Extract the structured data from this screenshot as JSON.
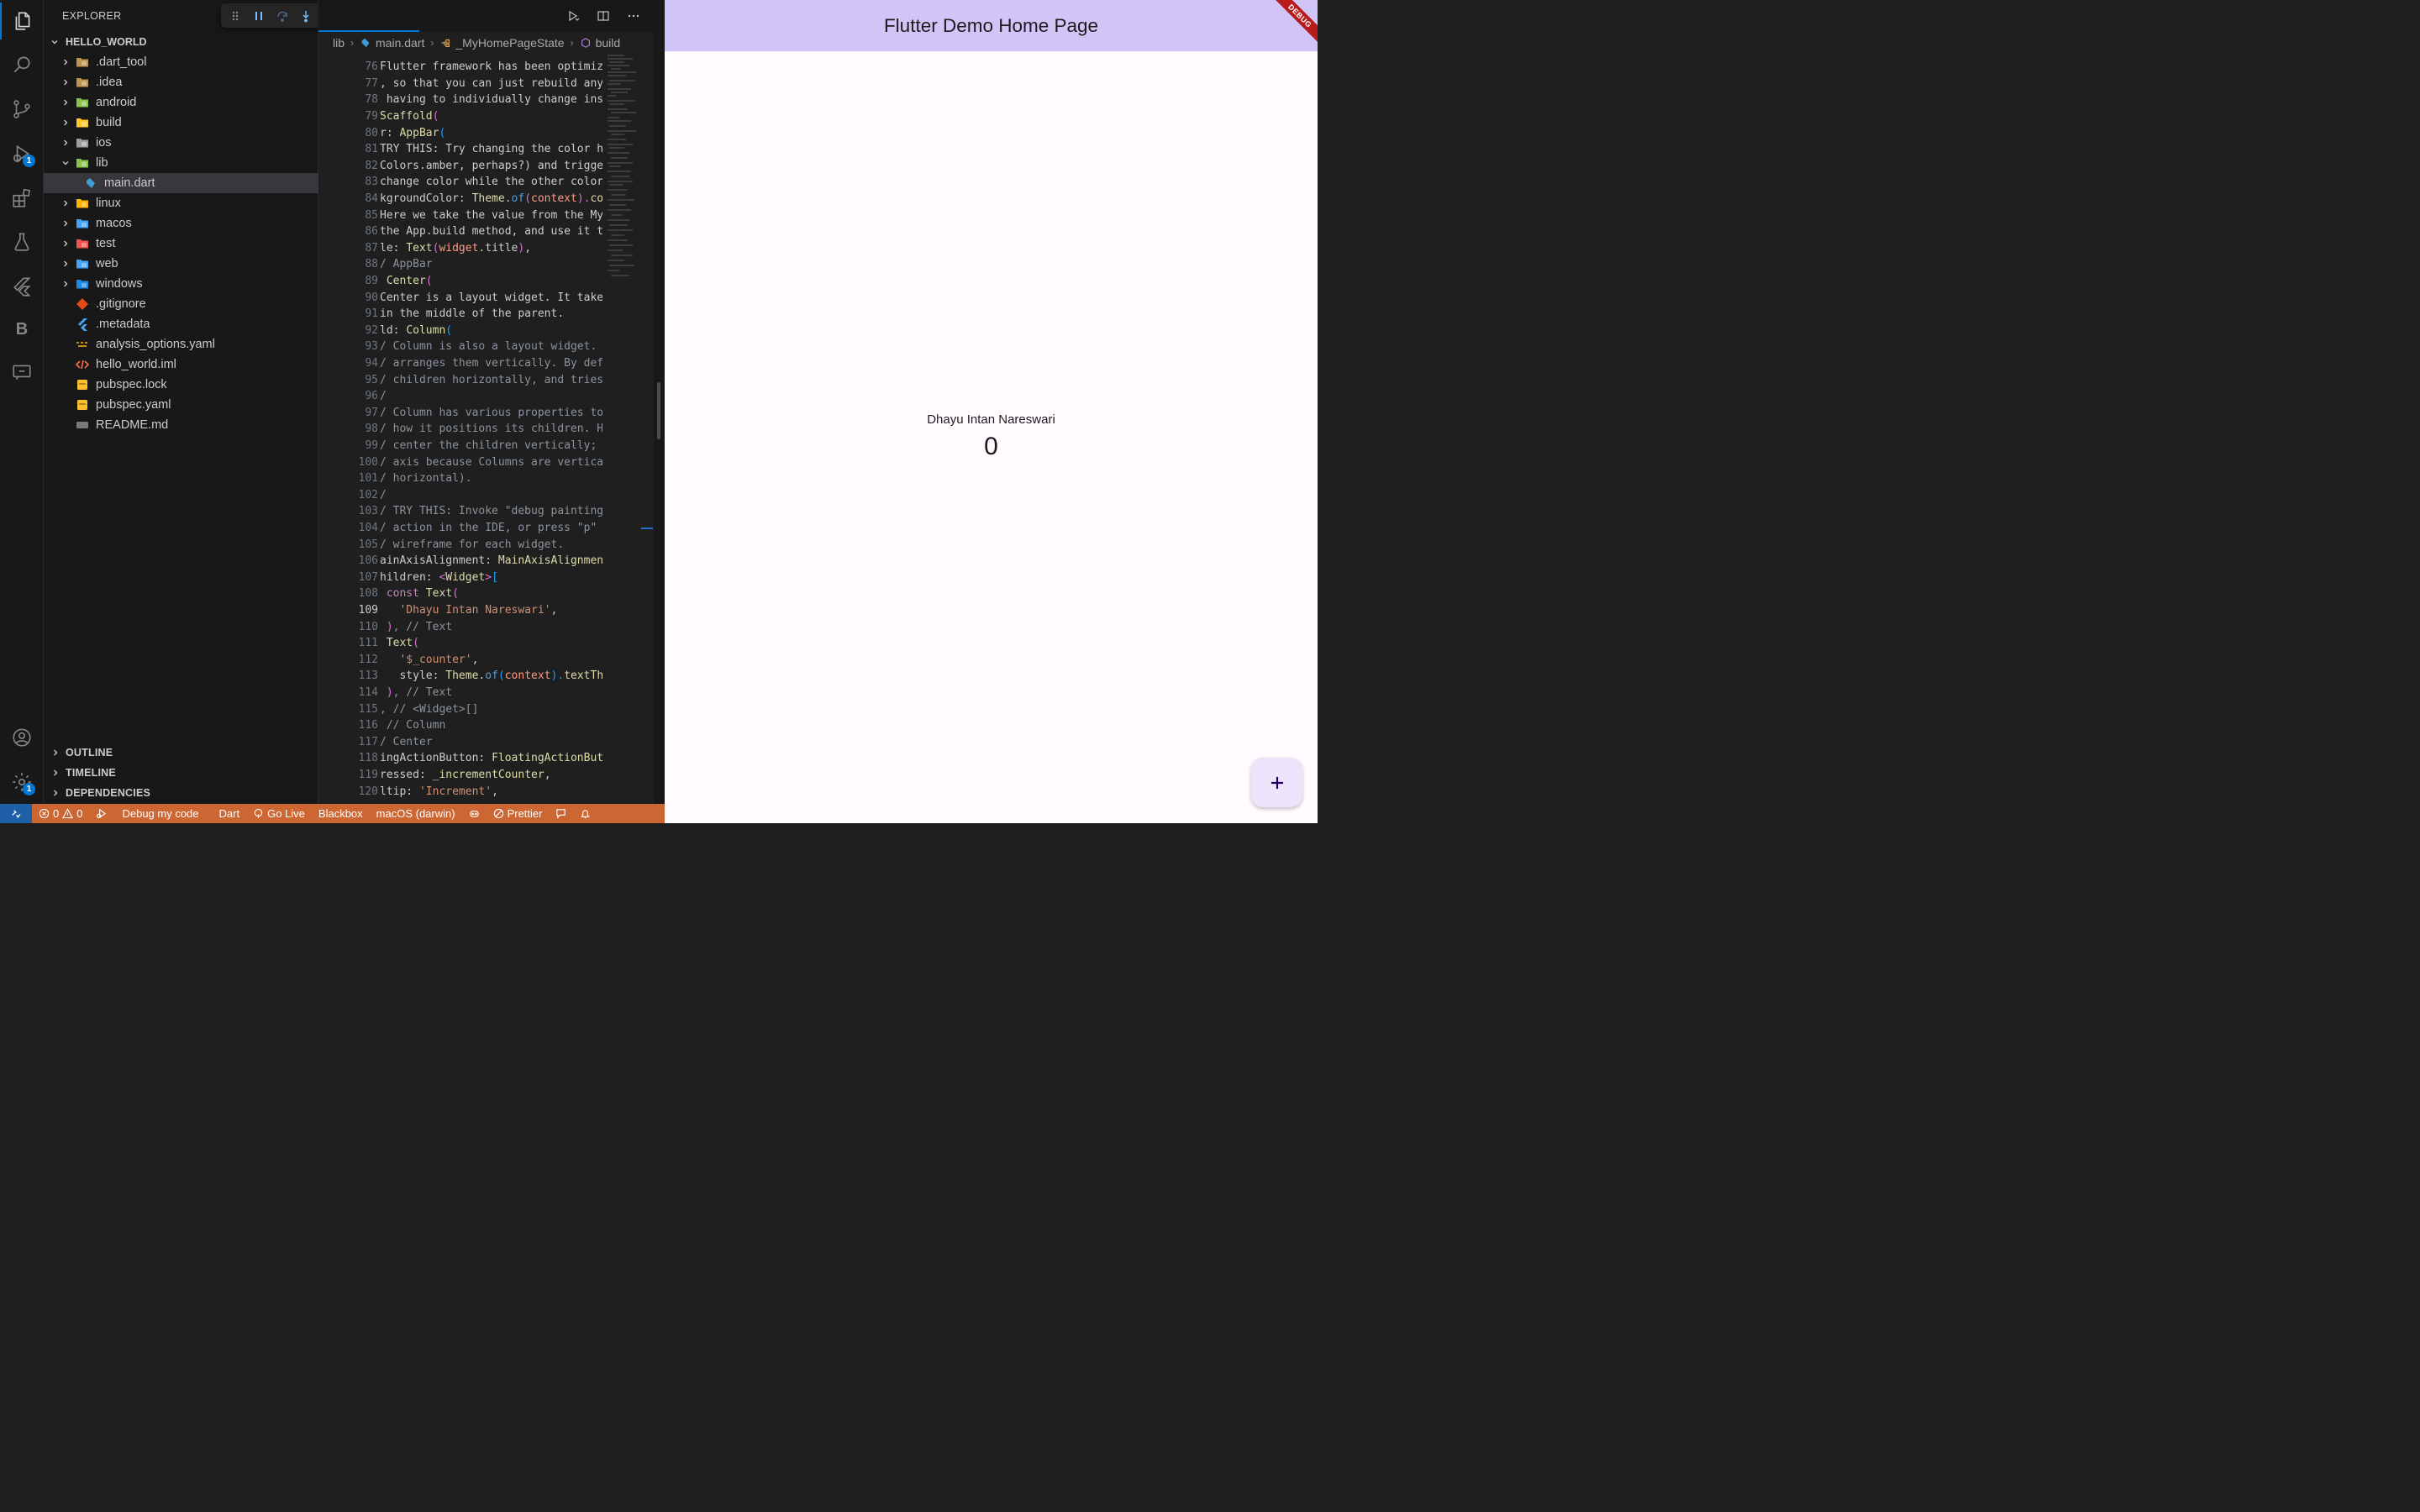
{
  "explorer": {
    "title": "EXPLORER",
    "root": "HELLO_WORLD",
    "items": [
      {
        "label": ".dart_tool",
        "kind": "folder",
        "icon": "folder-icon",
        "expanded": false
      },
      {
        "label": ".idea",
        "kind": "folder",
        "icon": "folder-idea-icon",
        "expanded": false
      },
      {
        "label": "android",
        "kind": "folder",
        "icon": "folder-android-icon",
        "expanded": false
      },
      {
        "label": "build",
        "kind": "folder",
        "icon": "folder-build-icon",
        "expanded": false
      },
      {
        "label": "ios",
        "kind": "folder",
        "icon": "folder-ios-icon",
        "expanded": false
      },
      {
        "label": "lib",
        "kind": "folder",
        "icon": "folder-lib-icon",
        "expanded": true
      },
      {
        "label": "main.dart",
        "kind": "file",
        "icon": "dart-file-icon",
        "selected": true
      },
      {
        "label": "linux",
        "kind": "folder",
        "icon": "folder-linux-icon",
        "expanded": false
      },
      {
        "label": "macos",
        "kind": "folder",
        "icon": "folder-macos-icon",
        "expanded": false
      },
      {
        "label": "test",
        "kind": "folder",
        "icon": "folder-test-icon",
        "expanded": false
      },
      {
        "label": "web",
        "kind": "folder",
        "icon": "folder-web-icon",
        "expanded": false
      },
      {
        "label": "windows",
        "kind": "folder",
        "icon": "folder-windows-icon",
        "expanded": false
      },
      {
        "label": ".gitignore",
        "kind": "file",
        "icon": "git-file-icon"
      },
      {
        "label": ".metadata",
        "kind": "file",
        "icon": "flutter-file-icon"
      },
      {
        "label": "analysis_options.yaml",
        "kind": "file",
        "icon": "yaml-file-icon"
      },
      {
        "label": "hello_world.iml",
        "kind": "file",
        "icon": "xml-file-icon"
      },
      {
        "label": "pubspec.lock",
        "kind": "file",
        "icon": "lock-file-icon"
      },
      {
        "label": "pubspec.yaml",
        "kind": "file",
        "icon": "pubspec-file-icon"
      },
      {
        "label": "README.md",
        "kind": "file",
        "icon": "markdown-file-icon"
      }
    ],
    "sections": [
      "OUTLINE",
      "TIMELINE",
      "DEPENDENCIES"
    ]
  },
  "activity_bar": {
    "icons": [
      "explorer-icon",
      "search-icon",
      "source-control-icon",
      "run-debug-icon",
      "extensions-icon",
      "testing-icon",
      "flutter-icon",
      "blackbox-icon",
      "remote-explorer-icon",
      "account-icon",
      "settings-icon"
    ],
    "debug_badge": "1",
    "settings_badge": "1"
  },
  "debug_toolbar": {
    "buttons": [
      "drag-handle-icon",
      "pause-icon",
      "step-over-icon",
      "step-into-icon",
      "step-out-icon",
      "hot-reload-icon",
      "hot-restart-icon",
      "stop-icon",
      "devtools-icon"
    ]
  },
  "breadcrumb": {
    "folder": "lib",
    "file": "main.dart",
    "class": "_MyHomePageState",
    "method": "build"
  },
  "editor": {
    "current_line": 109,
    "lines": [
      {
        "n": "76",
        "t": [
          [
            "Flutter framework has been optimiz",
            "#cccccc"
          ]
        ]
      },
      {
        "n": "77",
        "t": [
          [
            ", so that you can just rebuild any",
            "#cccccc"
          ]
        ]
      },
      {
        "n": "78",
        "t": [
          [
            " having to individually change ins",
            "#cccccc"
          ]
        ]
      },
      {
        "n": "79",
        "t": [
          [
            "Scaffold",
            "#dcdcaa"
          ],
          [
            "(",
            "#da70d6"
          ]
        ]
      },
      {
        "n": "80",
        "t": [
          [
            "r",
            "#cccccc"
          ],
          [
            ": ",
            "#cccccc"
          ],
          [
            "AppBar",
            "#dcdcaa"
          ],
          [
            "(",
            "#179fff"
          ]
        ]
      },
      {
        "n": "81",
        "t": [
          [
            "TRY THIS: Try changing the color h",
            "#cccccc"
          ]
        ]
      },
      {
        "n": "82",
        "t": [
          [
            "Colors.amber, perhaps?) and trigge",
            "#cccccc"
          ]
        ]
      },
      {
        "n": "83",
        "t": [
          [
            "change color while the other color",
            "#cccccc"
          ]
        ]
      },
      {
        "n": "84",
        "t": [
          [
            "kgroundColor: ",
            "#cccccc"
          ],
          [
            "Theme",
            "#dcdcaa"
          ],
          [
            ".",
            "#cccccc"
          ],
          [
            "of",
            "#569cd6"
          ],
          [
            "(",
            "#da70d6"
          ],
          [
            "context",
            "#ff9b82"
          ],
          [
            ").",
            "#da70d6"
          ],
          [
            "co",
            "#dcdcaa"
          ]
        ]
      },
      {
        "n": "85",
        "t": [
          [
            "Here we take the value from the My",
            "#cccccc"
          ]
        ]
      },
      {
        "n": "86",
        "t": [
          [
            "the App.build method, and use it t",
            "#cccccc"
          ]
        ]
      },
      {
        "n": "87",
        "t": [
          [
            "le: ",
            "#cccccc"
          ],
          [
            "Text",
            "#dcdcaa"
          ],
          [
            "(",
            "#da70d6"
          ],
          [
            "widget",
            "#ff9b82"
          ],
          [
            ".title",
            "#cccccc"
          ],
          [
            ")",
            "#da70d6"
          ],
          [
            ",",
            "#cccccc"
          ]
        ]
      },
      {
        "n": "88",
        "t": [
          [
            "/ AppBar",
            "#8b949e"
          ]
        ]
      },
      {
        "n": "89",
        "t": [
          [
            " Center",
            "#dcdcaa"
          ],
          [
            "(",
            "#da70d6"
          ]
        ]
      },
      {
        "n": "90",
        "t": [
          [
            "Center is a layout widget. It take",
            "#cccccc"
          ]
        ]
      },
      {
        "n": "91",
        "t": [
          [
            "in the middle of the parent.",
            "#cccccc"
          ]
        ]
      },
      {
        "n": "92",
        "t": [
          [
            "ld: ",
            "#cccccc"
          ],
          [
            "Column",
            "#dcdcaa"
          ],
          [
            "(",
            "#179fff"
          ]
        ]
      },
      {
        "n": "93",
        "t": [
          [
            "/ Column is also a layout widget. ",
            "#8b949e"
          ]
        ]
      },
      {
        "n": "94",
        "t": [
          [
            "/ arranges them vertically. By def",
            "#8b949e"
          ]
        ]
      },
      {
        "n": "95",
        "t": [
          [
            "/ children horizontally, and tries",
            "#8b949e"
          ]
        ]
      },
      {
        "n": "96",
        "t": [
          [
            "/",
            "#8b949e"
          ]
        ]
      },
      {
        "n": "97",
        "t": [
          [
            "/ Column has various properties to",
            "#8b949e"
          ]
        ]
      },
      {
        "n": "98",
        "t": [
          [
            "/ how it positions its children. H",
            "#8b949e"
          ]
        ]
      },
      {
        "n": "99",
        "t": [
          [
            "/ center the children vertically; ",
            "#8b949e"
          ]
        ]
      },
      {
        "n": "100",
        "t": [
          [
            "/ axis because Columns are vertica",
            "#8b949e"
          ]
        ]
      },
      {
        "n": "101",
        "t": [
          [
            "/ horizontal).",
            "#8b949e"
          ]
        ]
      },
      {
        "n": "102",
        "t": [
          [
            "/",
            "#8b949e"
          ]
        ]
      },
      {
        "n": "103",
        "t": [
          [
            "/ TRY THIS: Invoke \"debug painting",
            "#8b949e"
          ]
        ]
      },
      {
        "n": "104",
        "t": [
          [
            "/ action in the IDE, or press \"p\" ",
            "#8b949e"
          ]
        ]
      },
      {
        "n": "105",
        "t": [
          [
            "/ wireframe for each widget.",
            "#8b949e"
          ]
        ]
      },
      {
        "n": "106",
        "t": [
          [
            "ainAxisAlignment: ",
            "#cccccc"
          ],
          [
            "MainAxisAlignmen",
            "#dcdcaa"
          ]
        ]
      },
      {
        "n": "107",
        "t": [
          [
            "hildren: ",
            "#cccccc"
          ],
          [
            "<",
            "#da70d6"
          ],
          [
            "Widget",
            "#dcdcaa"
          ],
          [
            ">",
            "#da70d6"
          ],
          [
            "[",
            "#179fff"
          ]
        ]
      },
      {
        "n": "108",
        "t": [
          [
            " const ",
            "#c586c0"
          ],
          [
            "Text",
            "#dcdcaa"
          ],
          [
            "(",
            "#da70d6"
          ]
        ]
      },
      {
        "n": "109",
        "t": [
          [
            "   ",
            "#cccccc"
          ],
          [
            "'Dhayu Intan Nareswari'",
            "#ce9178"
          ],
          [
            ",",
            "#cccccc"
          ]
        ]
      },
      {
        "n": "110",
        "t": [
          [
            " )",
            "#da70d6"
          ],
          [
            ", // Text",
            "#8b949e"
          ]
        ]
      },
      {
        "n": "111",
        "t": [
          [
            " Text",
            "#dcdcaa"
          ],
          [
            "(",
            "#da70d6"
          ]
        ]
      },
      {
        "n": "112",
        "t": [
          [
            "   ",
            "#cccccc"
          ],
          [
            "'$_counter'",
            "#ce9178"
          ],
          [
            ",",
            "#cccccc"
          ]
        ]
      },
      {
        "n": "113",
        "t": [
          [
            "   style: ",
            "#cccccc"
          ],
          [
            "Theme",
            "#dcdcaa"
          ],
          [
            ".",
            "#cccccc"
          ],
          [
            "of",
            "#569cd6"
          ],
          [
            "(",
            "#179fff"
          ],
          [
            "context",
            "#ff9b82"
          ],
          [
            ").",
            "#179fff"
          ],
          [
            "textTh",
            "#dcdcaa"
          ]
        ]
      },
      {
        "n": "114",
        "t": [
          [
            " )",
            "#da70d6"
          ],
          [
            ", // Text",
            "#8b949e"
          ]
        ]
      },
      {
        "n": "115",
        "t": [
          [
            ", // <Widget>[]",
            "#8b949e"
          ]
        ]
      },
      {
        "n": "116",
        "t": [
          [
            " // Column",
            "#8b949e"
          ]
        ]
      },
      {
        "n": "117",
        "t": [
          [
            "/ Center",
            "#8b949e"
          ]
        ]
      },
      {
        "n": "118",
        "t": [
          [
            "ingActionButton: ",
            "#cccccc"
          ],
          [
            "FloatingActionBut",
            "#dcdcaa"
          ]
        ]
      },
      {
        "n": "119",
        "t": [
          [
            "ressed: ",
            "#cccccc"
          ],
          [
            "_incrementCounter",
            "#dcdcaa"
          ],
          [
            ",",
            "#cccccc"
          ]
        ]
      },
      {
        "n": "120",
        "t": [
          [
            "ltip: ",
            "#cccccc"
          ],
          [
            "'Increment'",
            "#ce9178"
          ],
          [
            ",",
            "#cccccc"
          ]
        ]
      }
    ]
  },
  "status_bar": {
    "errors": "0",
    "warnings": "0",
    "debug_label": "Debug my code",
    "language": "Dart",
    "go_live": "Go Live",
    "blackbox": "Blackbox",
    "device": "macOS (darwin)",
    "prettier": "Prettier"
  },
  "app": {
    "title": "Flutter Demo Home Page",
    "debug_banner": "DEBUG",
    "name_text": "Dhayu Intan Nareswari",
    "counter": "0",
    "fab_icon": "add-icon"
  },
  "colors": {
    "status_bar": "#cc6633",
    "app_bar": "#d1c4f6",
    "accent": "#0078d4"
  }
}
